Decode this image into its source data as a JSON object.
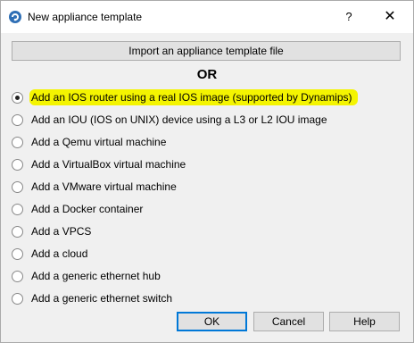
{
  "window": {
    "title": "New appliance template",
    "help_label": "?",
    "close_label": "✕"
  },
  "import_button": "Import an appliance template file",
  "or_label": "OR",
  "options": [
    {
      "label": "Add an IOS router using a real IOS image (supported by Dynamips)",
      "checked": true
    },
    {
      "label": "Add an IOU (IOS on UNIX) device using a L3 or L2 IOU image",
      "checked": false
    },
    {
      "label": "Add a Qemu virtual machine",
      "checked": false
    },
    {
      "label": "Add a VirtualBox virtual machine",
      "checked": false
    },
    {
      "label": "Add a VMware virtual machine",
      "checked": false
    },
    {
      "label": "Add a Docker container",
      "checked": false
    },
    {
      "label": "Add a VPCS",
      "checked": false
    },
    {
      "label": "Add a cloud",
      "checked": false
    },
    {
      "label": "Add a generic ethernet hub",
      "checked": false
    },
    {
      "label": "Add a generic ethernet switch",
      "checked": false
    }
  ],
  "buttons": {
    "ok": "OK",
    "cancel": "Cancel",
    "help": "Help"
  },
  "colors": {
    "highlight": "#f4f400",
    "default_button_border": "#0078d7"
  }
}
